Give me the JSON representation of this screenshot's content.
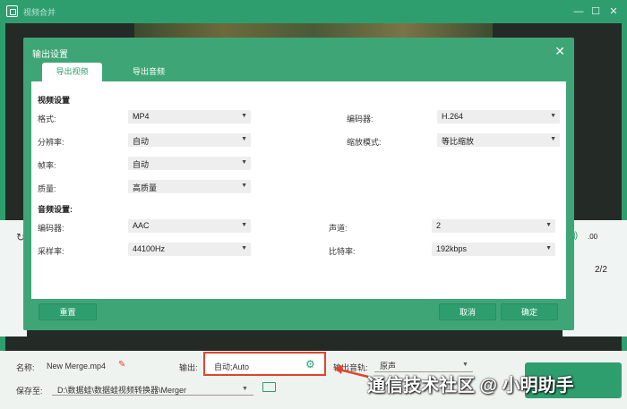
{
  "window": {
    "title": "视频合并",
    "minimize_icon": "minimize-icon",
    "maximize_icon": "maximize-icon",
    "close_icon": "close-icon"
  },
  "player": {
    "volume_value": ".00",
    "page_counter": "2/2"
  },
  "dialog": {
    "title": "输出设置",
    "tabs": [
      "导出视频",
      "导出音频"
    ],
    "video_section": "视频设置",
    "video_rows": [
      {
        "label": "格式:",
        "value": "MP4"
      },
      {
        "label": "分辨率:",
        "value": "自动"
      },
      {
        "label": "帧率:",
        "value": "自动"
      },
      {
        "label": "质量:",
        "value": "高质量"
      }
    ],
    "video_right_rows": [
      {
        "label": "编码器:",
        "value": "H.264"
      },
      {
        "label": "缩放模式:",
        "value": "等比缩放"
      }
    ],
    "audio_section": "音频设置:",
    "audio_rows": [
      {
        "label": "编码器:",
        "value": "AAC"
      },
      {
        "label": "采样率:",
        "value": "44100Hz"
      }
    ],
    "audio_right_rows": [
      {
        "label": "声道:",
        "value": "2"
      },
      {
        "label": "比特率:",
        "value": "192kbps"
      }
    ],
    "reset_label": "重置",
    "cancel_label": "取消",
    "ok_label": "确定"
  },
  "bottom": {
    "name_label": "名称:",
    "name_value": "New Merge.mp4",
    "output_label": "输出:",
    "output_value": "自动;Auto",
    "audio_track_label": "输出音轨:",
    "audio_track_value": "原声",
    "save_label": "保存至:",
    "save_path": "D:\\数据蛙\\数据蛙视频转换器\\Merger"
  },
  "watermark": "通信技术社区 @ 小明助手",
  "colors": {
    "accent": "#2f9e6e",
    "highlight": "#e2432b"
  }
}
